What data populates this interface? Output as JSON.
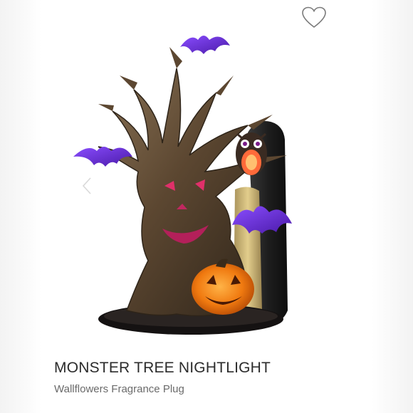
{
  "product": {
    "title": "MONSTER TREE NIGHTLIGHT",
    "subtitle": "Wallflowers Fragrance Plug"
  },
  "icons": {
    "favorite": "heart-outline-icon",
    "previous": "chevron-left-icon"
  },
  "colors": {
    "title_text": "#2b2b2b",
    "subtitle_text": "#6a6a6a",
    "bat_purple": "#6a2bd9",
    "pumpkin_orange": "#f07a10",
    "tree_bronze": "#5e4a33"
  }
}
